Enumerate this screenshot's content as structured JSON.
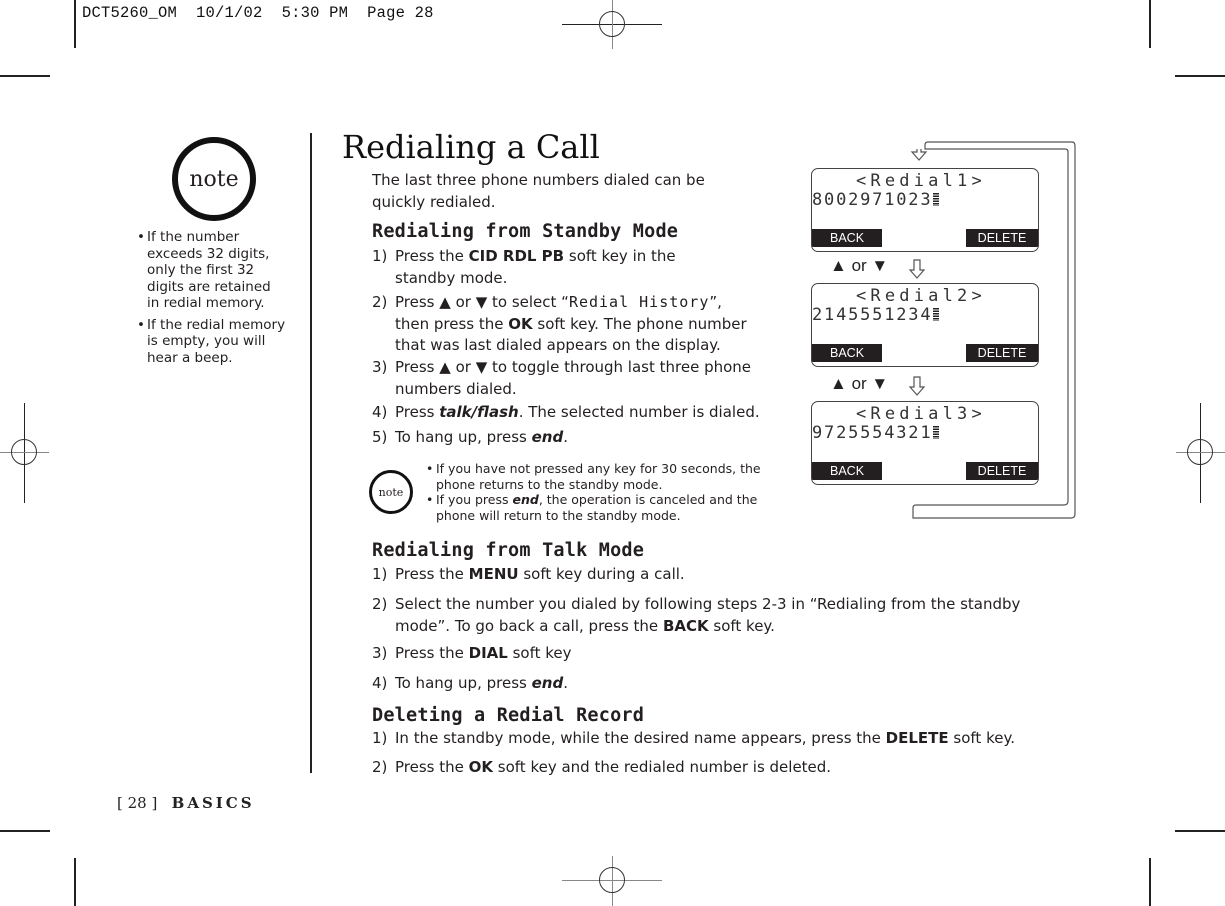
{
  "slug": {
    "file": "DCT5260_OM",
    "date": "10/1/02",
    "time": "5:30 PM",
    "page": "Page 28"
  },
  "sidebar": {
    "note_label": "note",
    "bullets": [
      "If the number exceeds 32 digits, only the first 32 digits are retained in redial memory.",
      "If the redial memory is empty, you will hear a beep."
    ],
    "bullet_lines": [
      [
        "If the number",
        "exceeds 32 digits,",
        "only the first 32",
        "digits are retained",
        "in redial memory."
      ],
      [
        "If the redial memory",
        "is empty, you will",
        "hear a beep."
      ]
    ]
  },
  "main": {
    "title": "Redialing a Call",
    "intro_lines": [
      "The last three phone numbers dialed can be",
      "quickly redialed."
    ],
    "standby": {
      "heading": "Redialing from Standby Mode",
      "steps": [
        {
          "n": "1)",
          "pre": "Press the ",
          "bold": "CID RDL PB",
          "post": " soft key in the",
          "line2": "standby mode."
        },
        {
          "n": "2)",
          "pre": "Press ",
          "up": "▲",
          "or": " or ",
          "down": "▼",
          "mid": " to select “",
          "lcd": "Redial History",
          "post": "”,",
          "line2a": "then press the ",
          "line2bold": "OK",
          "line2b": " soft key. The phone number",
          "line3": "that was last dialed appears on the display."
        },
        {
          "n": "3)",
          "pre": "Press ",
          "up": "▲",
          "or": " or ",
          "down": "▼",
          "post": " to toggle through last three phone",
          "line2": "numbers dialed."
        },
        {
          "n": "4)",
          "pre": "Press ",
          "bi": "talk/flash",
          "post": ". The selected number is dialed."
        },
        {
          "n": "5)",
          "pre": "To hang up, press ",
          "bi": "end",
          "post": "."
        }
      ]
    },
    "inline_note": {
      "label": "note",
      "bullet1_lines": [
        "If you have not pressed any key for 30 seconds, the",
        "phone returns to the standby mode."
      ],
      "bullet2_pre": "If you press ",
      "bullet2_bi": "end",
      "bullet2_post": ", the operation is canceled and the",
      "bullet2_line2": "phone will return to the standby mode."
    },
    "talk": {
      "heading": "Redialing from Talk Mode",
      "steps": [
        {
          "n": "1)",
          "pre": "Press the ",
          "bold": "MENU",
          "post": " soft key during a call."
        },
        {
          "n": "2)",
          "pre": "Select the number you dialed by following steps 2-3 in “Redialing from the standby",
          "line2a": "mode”. To go back a call, press the ",
          "line2bold": "BACK",
          "line2b": " soft key."
        },
        {
          "n": "3)",
          "pre": "Press the ",
          "bold": "DIAL",
          "post": " soft key"
        },
        {
          "n": "4)",
          "pre": "To hang up, press ",
          "bi": "end",
          "post": "."
        }
      ]
    },
    "delete": {
      "heading": "Deleting a Redial Record",
      "steps": [
        {
          "n": "1)",
          "pre": "In the standby mode, while the desired name appears, press the ",
          "bold": "DELETE",
          "post": " soft key."
        },
        {
          "n": "2)",
          "pre": "Press the ",
          "bold": "OK",
          "post": " soft key and the redialed number is deleted."
        }
      ]
    }
  },
  "diagram": {
    "screens": [
      {
        "header": "<Redial1>",
        "number": "8002971023",
        "back": "BACK",
        "delete": "DELETE"
      },
      {
        "header": "<Redial2>",
        "number": "2145551234",
        "back": "BACK",
        "delete": "DELETE"
      },
      {
        "header": "<Redial3>",
        "number": "9725554321",
        "back": "BACK",
        "delete": "DELETE"
      }
    ],
    "nav": {
      "up": "▲",
      "or": "or",
      "down": "▼"
    }
  },
  "footer": {
    "page_num": "[ 28 ]",
    "section": "BASICS"
  }
}
